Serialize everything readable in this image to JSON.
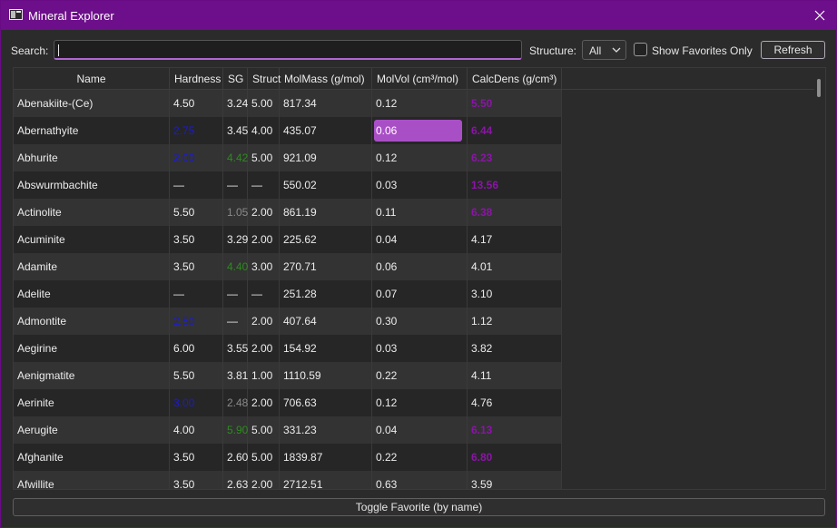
{
  "window": {
    "title": "Mineral Explorer",
    "accent": "#6d0f8a"
  },
  "toolbar": {
    "search_label": "Search:",
    "search_value": "",
    "structure_label": "Structure:",
    "structure_value": "All",
    "favorites_label": "Show Favorites Only",
    "favorites_checked": false,
    "refresh_label": "Refresh"
  },
  "table": {
    "columns": [
      "Name",
      "Hardness",
      "SG",
      "Struct",
      "MolMass (g/mol)",
      "MolVol (cm³/mol)",
      "CalcDens (g/cm³)"
    ],
    "rows": [
      {
        "name": "Abenakiite-(Ce)",
        "hardness": "4.50",
        "sg": "3.24",
        "struct": "5.00",
        "molmass": "817.34",
        "molvol": "0.12",
        "calcdens": "5.50",
        "hardness_color": "",
        "sg_color": "",
        "calcdens_color": "purple"
      },
      {
        "name": "Abernathyite",
        "hardness": "2.75",
        "sg": "3.45",
        "struct": "4.00",
        "molmass": "435.07",
        "molvol": "0.06",
        "calcdens": "6.44",
        "hardness_color": "blue",
        "sg_color": "",
        "calcdens_color": "purple",
        "selected": "molvol"
      },
      {
        "name": "Abhurite",
        "hardness": "2.00",
        "sg": "4.42",
        "struct": "5.00",
        "molmass": "921.09",
        "molvol": "0.12",
        "calcdens": "6.23",
        "hardness_color": "blue",
        "sg_color": "green",
        "calcdens_color": "purple"
      },
      {
        "name": "Abswurmbachite",
        "hardness": "—",
        "sg": "—",
        "struct": "—",
        "molmass": "550.02",
        "molvol": "0.03",
        "calcdens": "13.56",
        "hardness_color": "",
        "sg_color": "",
        "calcdens_color": "purple"
      },
      {
        "name": "Actinolite",
        "hardness": "5.50",
        "sg": "1.05",
        "struct": "2.00",
        "molmass": "861.19",
        "molvol": "0.11",
        "calcdens": "6.38",
        "hardness_color": "",
        "sg_color": "gray",
        "calcdens_color": "purple"
      },
      {
        "name": "Acuminite",
        "hardness": "3.50",
        "sg": "3.29",
        "struct": "2.00",
        "molmass": "225.62",
        "molvol": "0.04",
        "calcdens": "4.17",
        "hardness_color": "",
        "sg_color": "",
        "calcdens_color": ""
      },
      {
        "name": "Adamite",
        "hardness": "3.50",
        "sg": "4.40",
        "struct": "3.00",
        "molmass": "270.71",
        "molvol": "0.06",
        "calcdens": "4.01",
        "hardness_color": "",
        "sg_color": "green",
        "calcdens_color": ""
      },
      {
        "name": "Adelite",
        "hardness": "—",
        "sg": "—",
        "struct": "—",
        "molmass": "251.28",
        "molvol": "0.07",
        "calcdens": "3.10",
        "hardness_color": "",
        "sg_color": "",
        "calcdens_color": ""
      },
      {
        "name": "Admontite",
        "hardness": "2.50",
        "sg": "—",
        "struct": "2.00",
        "molmass": "407.64",
        "molvol": "0.30",
        "calcdens": "1.12",
        "hardness_color": "blue",
        "sg_color": "",
        "calcdens_color": ""
      },
      {
        "name": "Aegirine",
        "hardness": "6.00",
        "sg": "3.55",
        "struct": "2.00",
        "molmass": "154.92",
        "molvol": "0.03",
        "calcdens": "3.82",
        "hardness_color": "",
        "sg_color": "",
        "calcdens_color": ""
      },
      {
        "name": "Aenigmatite",
        "hardness": "5.50",
        "sg": "3.81",
        "struct": "1.00",
        "molmass": "1110.59",
        "molvol": "0.22",
        "calcdens": "4.11",
        "hardness_color": "",
        "sg_color": "",
        "calcdens_color": ""
      },
      {
        "name": "Aerinite",
        "hardness": "3.00",
        "sg": "2.48",
        "struct": "2.00",
        "molmass": "706.63",
        "molvol": "0.12",
        "calcdens": "4.76",
        "hardness_color": "blue",
        "sg_color": "gray",
        "calcdens_color": ""
      },
      {
        "name": "Aerugite",
        "hardness": "4.00",
        "sg": "5.90",
        "struct": "5.00",
        "molmass": "331.23",
        "molvol": "0.04",
        "calcdens": "6.13",
        "hardness_color": "",
        "sg_color": "green",
        "calcdens_color": "purple"
      },
      {
        "name": "Afghanite",
        "hardness": "3.50",
        "sg": "2.60",
        "struct": "5.00",
        "molmass": "1839.87",
        "molvol": "0.22",
        "calcdens": "6.80",
        "hardness_color": "",
        "sg_color": "",
        "calcdens_color": "purple"
      },
      {
        "name": "Afwillite",
        "hardness": "3.50",
        "sg": "2.63",
        "struct": "2.00",
        "molmass": "2712.51",
        "molvol": "0.63",
        "calcdens": "3.59",
        "hardness_color": "",
        "sg_color": "",
        "calcdens_color": ""
      }
    ]
  },
  "colors": {
    "blue": "#1a1ad6",
    "green": "#2e8b1f",
    "gray": "#8a8a8a",
    "purple": "#8a15a6",
    "selection": "#a94fc6"
  },
  "footer": {
    "toggle_label": "Toggle Favorite (by name)"
  }
}
